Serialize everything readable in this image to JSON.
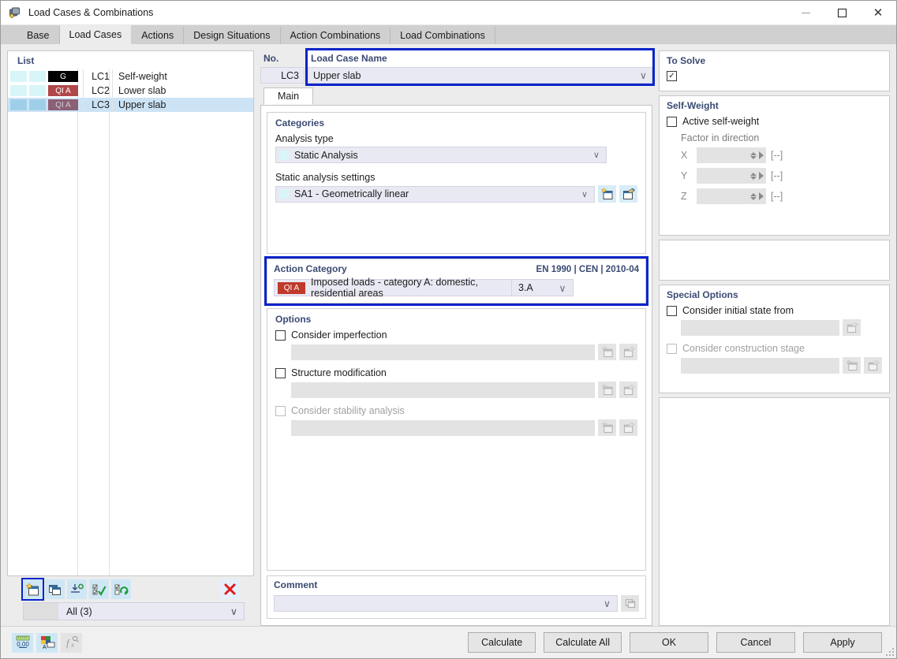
{
  "window": {
    "title": "Load Cases & Combinations",
    "icon": "load-case-icon",
    "minimize": "—",
    "maximize": "□",
    "close": "✕"
  },
  "tabs": [
    {
      "label": "Base",
      "active": false
    },
    {
      "label": "Load Cases",
      "active": true
    },
    {
      "label": "Actions",
      "active": false
    },
    {
      "label": "Design Situations",
      "active": false
    },
    {
      "label": "Action Combinations",
      "active": false
    },
    {
      "label": "Load Combinations",
      "active": false
    }
  ],
  "list": {
    "header": "List",
    "rows": [
      {
        "badge": "G",
        "badge_color": "#000000",
        "badge_text_color": "#ffffff",
        "sw1": "#d8f5f7",
        "sw2": "#d8f5f7",
        "no": "LC1",
        "name": "Self-weight",
        "selected": false
      },
      {
        "badge": "QI A",
        "badge_color": "#b0474a",
        "badge_text_color": "#ffffff",
        "sw1": "#d8f5f7",
        "sw2": "#d8f5f7",
        "no": "LC2",
        "name": "Lower slab",
        "selected": false
      },
      {
        "badge": "QI A",
        "badge_color": "#8b5f74",
        "badge_text_color": "#cfcfd6",
        "sw1": "#9fcfe8",
        "sw2": "#9fcfe8",
        "no": "LC3",
        "name": "Upper slab",
        "selected": true
      }
    ],
    "toolbar": [
      {
        "name": "new-load-case-button",
        "icon": "new-window-icon",
        "highlighted": true
      },
      {
        "name": "copy-load-case-button",
        "icon": "copy-windows-icon",
        "highlighted": false
      },
      {
        "name": "import-load-case-button",
        "icon": "import-icon",
        "highlighted": false
      },
      {
        "name": "select-all-button",
        "icon": "checklist-check-icon",
        "highlighted": false
      },
      {
        "name": "invert-selection-button",
        "icon": "checklist-refresh-icon",
        "highlighted": false
      },
      {
        "name": "delete-load-case-button",
        "icon": "red-x-icon",
        "highlighted": false
      }
    ],
    "filter": {
      "label": "All (3)",
      "caret": "∨"
    }
  },
  "fields": {
    "no_label": "No.",
    "no_value": "LC3",
    "name_label": "Load Case Name",
    "name_value": "Upper slab",
    "name_caret": "∨"
  },
  "to_solve": {
    "title": "To Solve",
    "checked": true,
    "check_glyph": "✓"
  },
  "inner_tabs": [
    {
      "label": "Main",
      "active": true
    }
  ],
  "categories": {
    "title": "Categories",
    "analysis_type_label": "Analysis type",
    "analysis_type_value": "Static Analysis",
    "static_settings_label": "Static analysis settings",
    "static_settings_value": "SA1 - Geometrically linear",
    "caret": "∨",
    "new_button_icon": "new-item-icon",
    "edit_button_icon": "edit-item-icon"
  },
  "action_category": {
    "title": "Action Category",
    "standard": "EN 1990 | CEN | 2010-04",
    "badge": "QI A",
    "badge_color": "#c0392b",
    "value": "Imposed loads - category A: domestic, residential areas",
    "code": "3.A",
    "caret": "∨",
    "highlighted": true
  },
  "options": {
    "title": "Options",
    "items": [
      {
        "label": "Consider imperfection",
        "checked": false,
        "disabled": false,
        "buttons": [
          "new-item-icon",
          "edit-item-icon"
        ]
      },
      {
        "label": "Structure modification",
        "checked": false,
        "disabled": false,
        "buttons": [
          "new-item-icon",
          "edit-item-icon"
        ]
      },
      {
        "label": "Consider stability analysis",
        "checked": false,
        "disabled": true,
        "buttons": [
          "new-item-icon",
          "edit-item-icon"
        ]
      }
    ]
  },
  "comment": {
    "title": "Comment",
    "value": "",
    "caret": "∨",
    "button_icon": "comment-library-icon"
  },
  "self_weight": {
    "title": "Self-Weight",
    "active_label": "Active self-weight",
    "active_checked": false,
    "factor_title": "Factor in direction",
    "axes": [
      {
        "label": "X",
        "value": "",
        "unit": "[--]"
      },
      {
        "label": "Y",
        "value": "",
        "unit": "[--]"
      },
      {
        "label": "Z",
        "value": "",
        "unit": "[--]"
      }
    ]
  },
  "special_options": {
    "title": "Special Options",
    "items": [
      {
        "label": "Consider initial state from",
        "checked": false,
        "disabled": false,
        "buttons": [
          "edit-item-icon"
        ]
      },
      {
        "label": "Consider construction stage",
        "checked": false,
        "disabled": true,
        "buttons": [
          "new-item-icon",
          "edit-item-icon"
        ]
      }
    ]
  },
  "footer": {
    "left_buttons": [
      {
        "name": "units-button",
        "icon": "ruler-000-icon",
        "disabled": false
      },
      {
        "name": "display-properties-button",
        "icon": "color-palette-icon",
        "disabled": false
      },
      {
        "name": "formula-button",
        "icon": "fx-icon",
        "disabled": true
      }
    ],
    "buttons": [
      {
        "label": "Calculate",
        "name": "calculate-button"
      },
      {
        "label": "Calculate All",
        "name": "calculate-all-button"
      },
      {
        "label": "OK",
        "name": "ok-button"
      },
      {
        "label": "Cancel",
        "name": "cancel-button"
      },
      {
        "label": "Apply",
        "name": "apply-button"
      }
    ]
  }
}
